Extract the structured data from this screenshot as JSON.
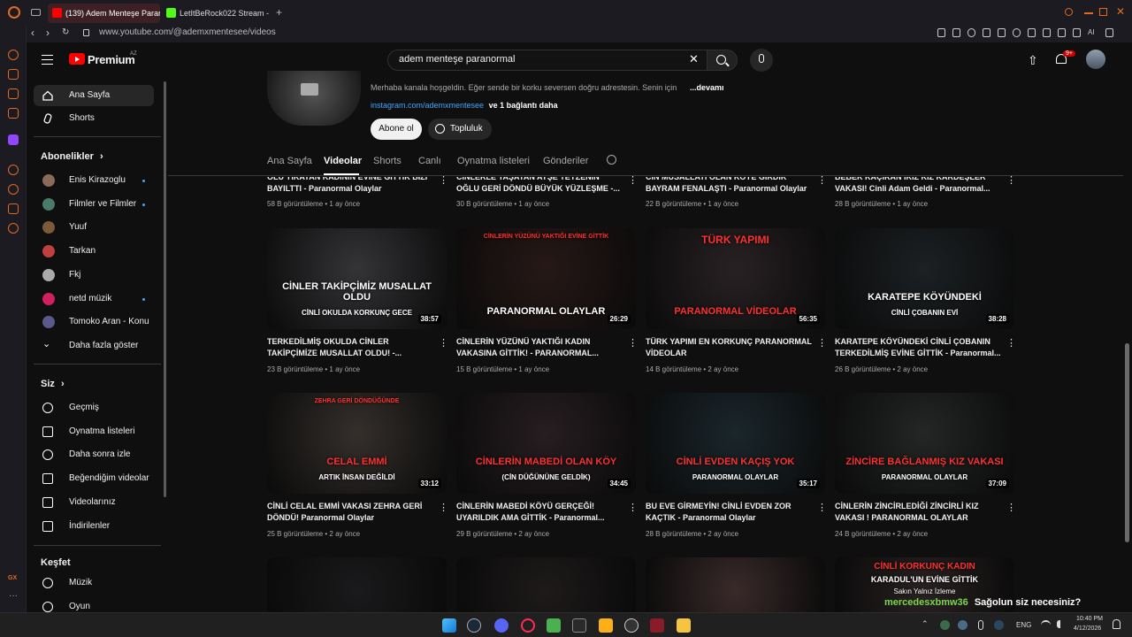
{
  "browser": {
    "tabs": [
      {
        "label": "(139) Adem Menteşe Parar",
        "color": "#ff0000"
      },
      {
        "label": "LetItBeRock022 Stream - Yi",
        "color": "#53fc18"
      }
    ],
    "url": "www.youtube.com/@ademxmentesee/videos"
  },
  "header": {
    "logo": "Premium",
    "logo_region": "AZ",
    "search_value": "adem menteşe paranormal",
    "notification_count": "9+"
  },
  "sidebar": {
    "main": [
      {
        "label": "Ana Sayfa",
        "icon": "home-icon"
      },
      {
        "label": "Shorts",
        "icon": "shorts-icon"
      }
    ],
    "subscriptions_title": "Abonelikler",
    "subscriptions": [
      {
        "label": "Enis Kirazoglu",
        "dot": true,
        "color": "#8a6a5a"
      },
      {
        "label": "Filmler ve Filmler",
        "dot": true,
        "color": "#4a7a6a"
      },
      {
        "label": "Yuuf",
        "dot": false,
        "color": "#7a5a3a"
      },
      {
        "label": "Tarkan",
        "dot": false,
        "color": "#c04040"
      },
      {
        "label": "Fkj",
        "dot": false,
        "color": "#aaaaaa"
      },
      {
        "label": "netd müzik",
        "dot": true,
        "color": "#d02060"
      },
      {
        "label": "Tomoko Aran - Konu",
        "dot": false,
        "color": "#5a5a8a"
      },
      {
        "label": "Daha fazla göster",
        "dot": false,
        "color": ""
      }
    ],
    "you_title": "Siz",
    "you": [
      {
        "label": "Geçmiş",
        "icon": "history-icon"
      },
      {
        "label": "Oynatma listeleri",
        "icon": "playlists-icon"
      },
      {
        "label": "Daha sonra izle",
        "icon": "watch-later-icon"
      },
      {
        "label": "Beğendiğim videolar",
        "icon": "like-icon"
      },
      {
        "label": "Videolarınız",
        "icon": "your-videos-icon"
      },
      {
        "label": "İndirilenler",
        "icon": "download-icon"
      }
    ],
    "explore_title": "Keşfet",
    "explore": [
      {
        "label": "Müzik",
        "icon": "music-icon"
      },
      {
        "label": "Oyun",
        "icon": "gaming-icon"
      }
    ]
  },
  "channel": {
    "description": "Merhaba kanala hoşgeldin. Eğer sende bir korku seversen doğru adrestesin. Senin için",
    "more": "...devamı",
    "link": "instagram.com/ademxmentesee",
    "link_more": "ve 1 bağlantı daha",
    "subscribe": "Abone ol",
    "community": "Topluluk",
    "tabs": [
      "Ana Sayfa",
      "Videolar",
      "Shorts",
      "Canlı",
      "Oynatma listeleri",
      "Gönderiler"
    ],
    "active_tab": "Videolar"
  },
  "top_row": [
    {
      "title": "ÖLÜ YIKAYAN KADININ EVİNE GİTTİK BİZİ BAYILTTI - Paranormal Olaylar",
      "meta": "58 B görüntüleme • 1 ay önce"
    },
    {
      "title": "CİNLERLE YAŞAYAN AYŞE TEYZENİN OĞLU GERİ DÖNDÜ BÜYÜK YÜZLEŞME -...",
      "meta": "30 B görüntüleme • 1 ay önce"
    },
    {
      "title": "CİN MUSALLATI OLAN KÖYE GİRDİK BAYRAM FENALAŞTI - Paranormal Olaylar",
      "meta": "22 B görüntüleme • 1 ay önce"
    },
    {
      "title": "BEBEK KAÇIRAN İKİZ KIZ KARDEŞLER VAKASI! Cinli Adam Geldi - Paranormal...",
      "meta": "28 B görüntüleme • 1 ay önce"
    }
  ],
  "videos": [
    {
      "title": "TERKEDİLMİŞ OKULDA CİNLER TAKİPÇİMİZE MUSALLAT OLDU! -...",
      "meta": "23 B görüntüleme • 1 ay önce",
      "duration": "38:57",
      "thumb_top": "",
      "thumb_bottom": "CİNLER TAKİPÇİMİZ MUSALLAT OLDU",
      "thumb_sub": "CİNLİ OKULDA KORKUNÇ GECE",
      "bg": "#3a3a3e",
      "accent": "#ff3030"
    },
    {
      "title": "CİNLERİN YÜZÜNÜ YAKTIĞI KADIN VAKASINA GİTTİK! - PARANORMAL...",
      "meta": "15 B görüntüleme • 1 ay önce",
      "duration": "26:29",
      "thumb_top": "CİNLERİN YÜZÜNÜ YAKTIĞI EVİNE GİTTİK",
      "thumb_bottom": "PARANORMAL OLAYLAR",
      "thumb_sub": "",
      "bg": "#2a1a18",
      "accent": "#ff3030"
    },
    {
      "title": "TÜRK YAPIMI EN KORKUNÇ PARANORMAL VİDEOLAR",
      "meta": "14 B görüntüleme • 2 ay önce",
      "duration": "56:35",
      "thumb_top": "TÜRK YAPIMI",
      "thumb_bottom": "PARANORMAL VİDEOLAR",
      "thumb_sub": "",
      "bg": "#2c2426",
      "accent": "#ff3030"
    },
    {
      "title": "KARATEPE KÖYÜNDEKİ CİNLİ ÇOBANIN TERKEDİLMİŞ EVİNE GİTTİK - Paranormal...",
      "meta": "26 B görüntüleme • 2 ay önce",
      "duration": "38:28",
      "thumb_top": "",
      "thumb_bottom": "KARATEPE KÖYÜNDEKİ",
      "thumb_sub": "CİNLİ ÇOBANIN EVİ",
      "bg": "#1e2326",
      "accent": "#ffffff"
    },
    {
      "title": "CİNLİ CELAL EMMİ VAKASI ZEHRA GERİ DÖNDÜ! Paranormal Olaylar",
      "meta": "25 B görüntüleme • 2 ay önce",
      "duration": "33:12",
      "thumb_top": "ZEHRA GERİ DÖNDÜĞÜNDE",
      "thumb_bottom": "CELAL EMMİ",
      "thumb_sub": "ARTIK İNSAN DEĞİLDİ",
      "bg": "#3a3430",
      "accent": "#ff3030"
    },
    {
      "title": "CİNLERİN MABEDİ KÖYÜ GERÇEĞİ! UYARILDIK AMA GİTTİK - Paranormal...",
      "meta": "29 B görüntüleme • 2 ay önce",
      "duration": "34:45",
      "thumb_top": "",
      "thumb_bottom": "CİNLERİN MABEDİ OLAN KÖY",
      "thumb_sub": "(CİN DÜĞÜNÜNE GELDİK)",
      "bg": "#2a2024",
      "accent": "#ff3030"
    },
    {
      "title": "BU EVE GİRMEYİN! CİNLİ EVDEN ZOR KAÇTIK - Paranormal Olaylar",
      "meta": "28 B görüntüleme • 2 ay önce",
      "duration": "35:17",
      "thumb_top": "",
      "thumb_bottom": "CİNLİ EVDEN KAÇIŞ YOK",
      "thumb_sub": "PARANORMAL OLAYLAR",
      "bg": "#1c2a30",
      "accent": "#ff3030"
    },
    {
      "title": "CİNLERİN ZİNCİRLEDİĞİ ZİNCİRLİ KIZ VAKASI ! PARANORMAL OLAYLAR",
      "meta": "24 B görüntüleme • 2 ay önce",
      "duration": "37:09",
      "thumb_top": "",
      "thumb_bottom": "ZİNCİRE BAĞLANMIŞ KIZ VAKASI",
      "thumb_sub": "PARANORMAL OLAYLAR",
      "bg": "#262a28",
      "accent": "#ff3030"
    }
  ],
  "bottom_row": [
    {
      "thumb_top": "",
      "bg": "#1a1a1c"
    },
    {
      "thumb_top": "",
      "bg": "#1e1a1a"
    },
    {
      "thumb_top": "",
      "bg": "#3a2a2a"
    },
    {
      "thumb_top": "CİNLİ KORKUNÇ KADIN",
      "thumb_sub": "KARADUL'UN EVİNE GİTTİK",
      "thumb_sub2": "Sakın Yalnız İzleme",
      "bg": "#2a2222"
    }
  ],
  "chat_overlay": {
    "user": "mercedesxbmw36",
    "message": "Sağolun siz necesiniz?"
  },
  "taskbar": {
    "lang": "ENG",
    "time": "10:40 PM",
    "date": "4/12/2026"
  }
}
